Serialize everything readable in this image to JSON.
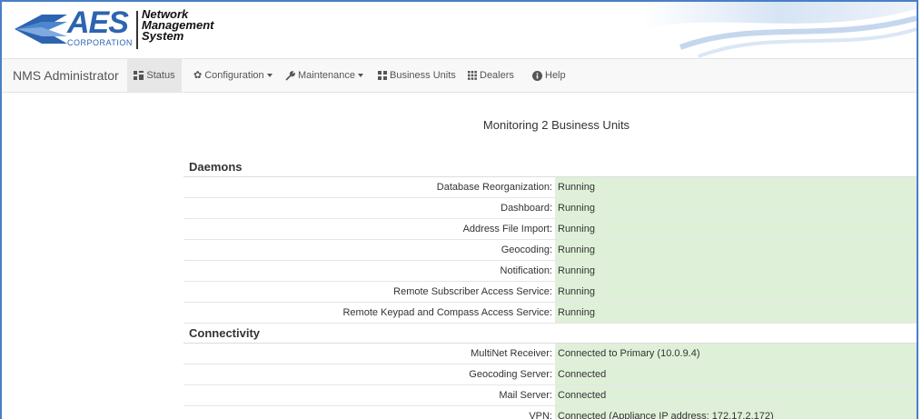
{
  "header": {
    "logo_text": "AES",
    "logo_sub": "CORPORATION",
    "system_name_1": "Network",
    "system_name_2": "Management",
    "system_name_3": "System"
  },
  "navbar": {
    "brand": "NMS Administrator",
    "items": [
      {
        "label": "Status",
        "icon": "dashboard-icon",
        "active": true
      },
      {
        "label": "Configuration",
        "icon": "gear-icon",
        "dropdown": true
      },
      {
        "label": "Maintenance",
        "icon": "wrench-icon",
        "dropdown": true
      },
      {
        "label": "Business Units",
        "icon": "grid-large-icon"
      },
      {
        "label": "Dealers",
        "icon": "grid-small-icon"
      },
      {
        "label": "Help",
        "icon": "info-circle-icon"
      }
    ]
  },
  "main": {
    "title": "Monitoring 2 Business Units",
    "sections": [
      {
        "heading": "Daemons",
        "rows": [
          {
            "label": "Database Reorganization:",
            "value": "Running"
          },
          {
            "label": "Dashboard:",
            "value": "Running"
          },
          {
            "label": "Address File Import:",
            "value": "Running"
          },
          {
            "label": "Geocoding:",
            "value": "Running"
          },
          {
            "label": "Notification:",
            "value": "Running"
          },
          {
            "label": "Remote Subscriber Access Service:",
            "value": "Running"
          },
          {
            "label": "Remote Keypad and Compass Access Service:",
            "value": "Running"
          }
        ]
      },
      {
        "heading": "Connectivity",
        "rows": [
          {
            "label": "MultiNet Receiver:",
            "value": "Connected to Primary (10.0.9.4)"
          },
          {
            "label": "Geocoding Server:",
            "value": "Connected"
          },
          {
            "label": "Mail Server:",
            "value": "Connected"
          },
          {
            "label": "VPN:",
            "value": "Connected (Appliance IP address: 172.17.2.172)"
          }
        ]
      }
    ]
  },
  "colors": {
    "ok_background": "#dff0d8",
    "brand_blue": "#2d64b0",
    "frame_border": "#4a7fc7"
  }
}
